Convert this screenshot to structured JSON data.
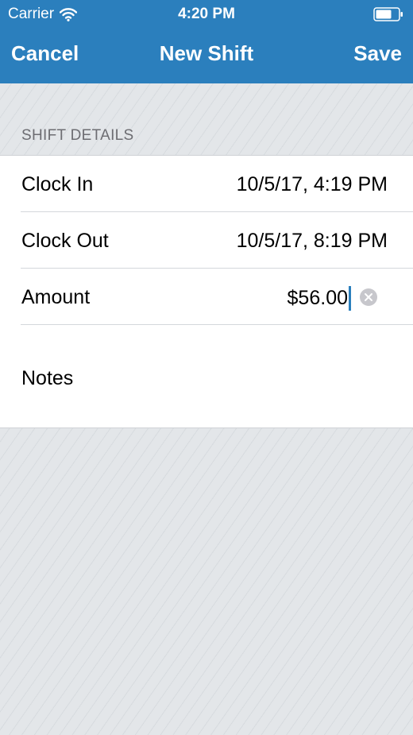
{
  "status_bar": {
    "carrier": "Carrier",
    "time": "4:20 PM",
    "wifi_icon": "wifi-icon",
    "battery_icon": "battery-icon"
  },
  "nav": {
    "cancel_label": "Cancel",
    "title": "New Shift",
    "save_label": "Save",
    "background_color": "#2b7fbd"
  },
  "section": {
    "header": "SHIFT DETAILS"
  },
  "rows": [
    {
      "label": "Clock In",
      "value": "10/5/17, 4:19 PM"
    },
    {
      "label": "Clock Out",
      "value": "10/5/17, 8:19 PM"
    },
    {
      "label": "Amount",
      "value": "$56.00",
      "clear_icon": "clear-circle-icon"
    },
    {
      "label": "Notes",
      "value": ""
    }
  ]
}
